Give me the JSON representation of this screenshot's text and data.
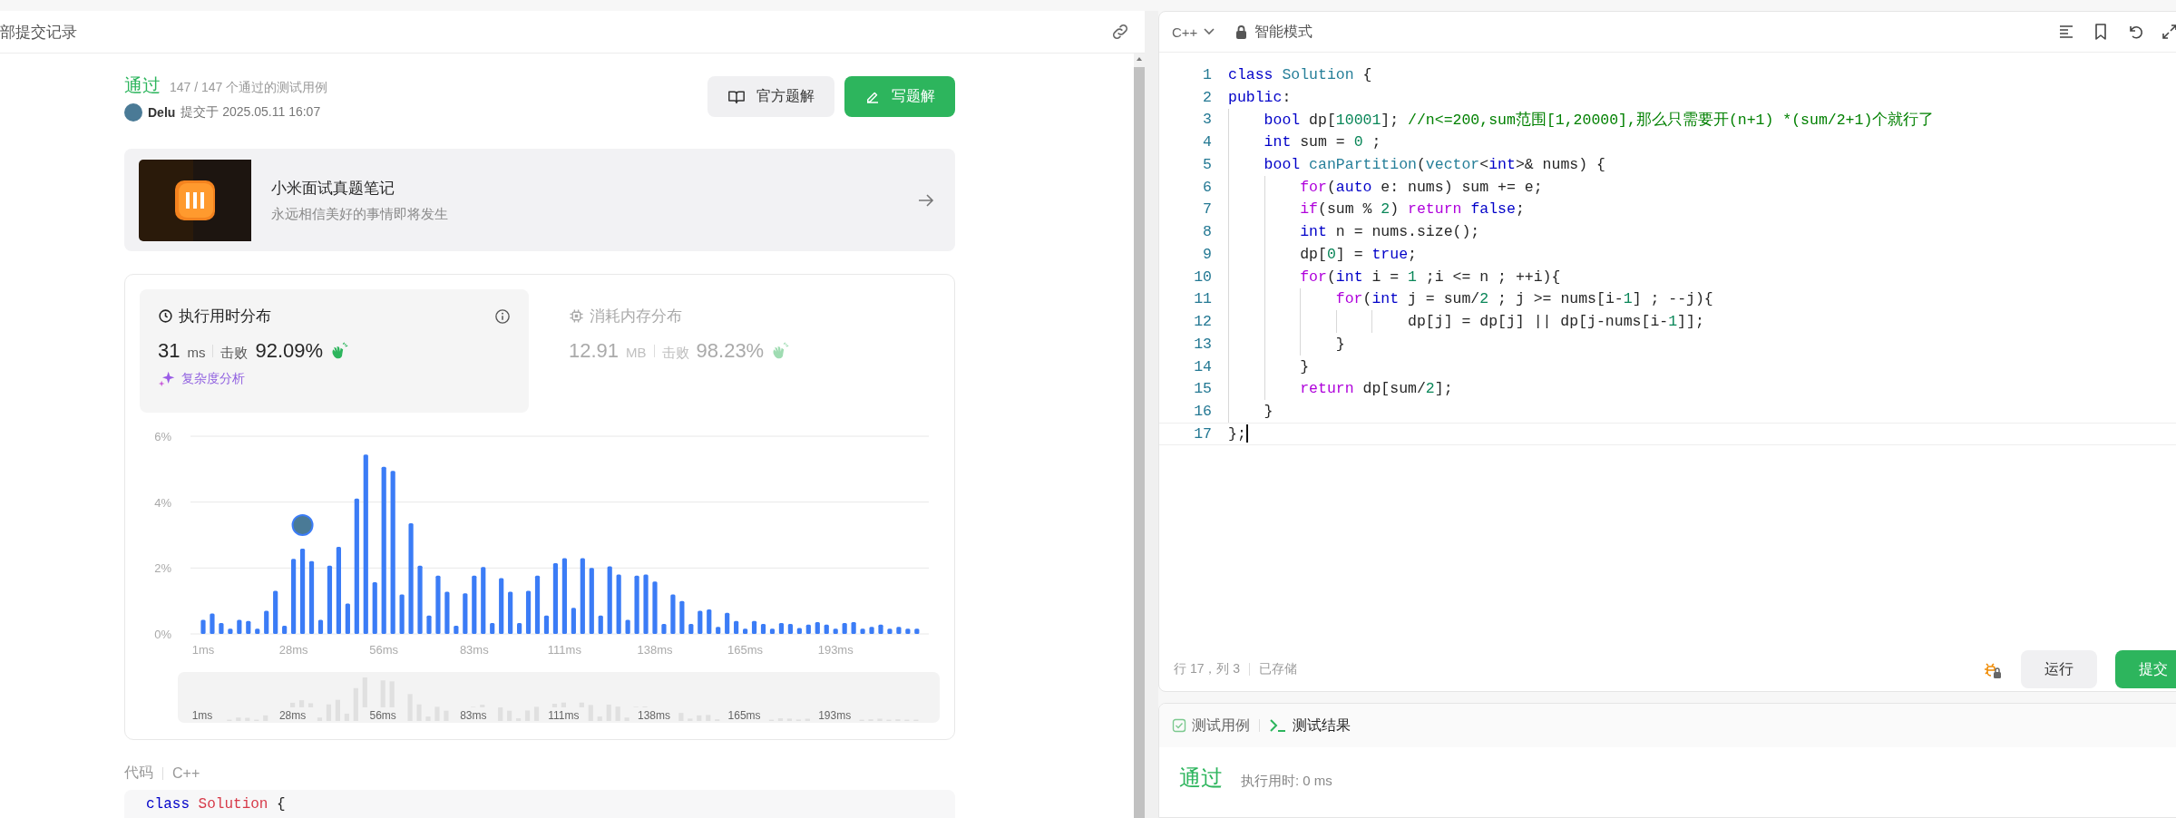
{
  "left_header": {
    "title": "部提交记录"
  },
  "submission": {
    "status": "通过",
    "cases": "147 / 147 个通过的测试用例",
    "user": "Delu",
    "submitted": "提交于 2025.05.11 16:07",
    "buttons": [
      {
        "label": "官方题解",
        "kind": "secondary"
      },
      {
        "label": "写题解",
        "kind": "primary"
      }
    ]
  },
  "promo": {
    "title": "小米面试真题笔记",
    "subtitle": "永远相信美好的事情即将发生"
  },
  "stats_tabs": [
    {
      "title": "执行用时分布",
      "selected": true,
      "kind": "runtime",
      "value": "31",
      "unit": "ms",
      "beats_label": "击败",
      "beats": "92.09%",
      "link": "复杂度分析"
    },
    {
      "title": "消耗内存分布",
      "selected": false,
      "kind": "memory",
      "value": "12.91",
      "unit": "MB",
      "beats_label": "击败",
      "beats": "98.23%"
    }
  ],
  "distribution": {
    "chart_data": {
      "type": "bar",
      "color": "#3b7cf6",
      "values": [
        0.43,
        0.62,
        0.33,
        0.16,
        0.43,
        0.39,
        0.16,
        0.7,
        1.31,
        0.25,
        2.28,
        2.59,
        2.21,
        0.43,
        2.07,
        2.64,
        0.92,
        4.11,
        5.44,
        1.57,
        5.07,
        4.95,
        1.2,
        3.36,
        2.07,
        0.56,
        1.77,
        1.28,
        0.25,
        1.23,
        1.77,
        2.03,
        0.33,
        1.69,
        1.28,
        0.33,
        1.31,
        1.77,
        0.56,
        2.15,
        2.3,
        0.79,
        2.3,
        2.0,
        0.56,
        2.05,
        1.8,
        0.43,
        1.77,
        1.8,
        1.59,
        0.3,
        1.2,
        1.0,
        0.3,
        0.7,
        0.74,
        0.21,
        0.64,
        0.39,
        0.16,
        0.39,
        0.3,
        0.16,
        0.33,
        0.3,
        0.18,
        0.28,
        0.36,
        0.28,
        0.16,
        0.33,
        0.36,
        0.16,
        0.21,
        0.28,
        0.16,
        0.21,
        0.16,
        0.16
      ],
      "ylim": [
        0,
        6
      ],
      "yticks": [
        {
          "value": 0,
          "label": "0%"
        },
        {
          "value": 2,
          "label": "2%"
        },
        {
          "value": 4,
          "label": "4%"
        },
        {
          "value": 6,
          "label": "6%"
        }
      ],
      "categories": [
        "1ms",
        null,
        null,
        null,
        null,
        null,
        null,
        null,
        null,
        null,
        "28ms",
        null,
        null,
        null,
        null,
        null,
        null,
        null,
        null,
        null,
        "56ms",
        null,
        null,
        null,
        null,
        null,
        null,
        null,
        null,
        null,
        "83ms",
        null,
        null,
        null,
        null,
        null,
        null,
        null,
        null,
        null,
        "111ms",
        null,
        null,
        null,
        null,
        null,
        null,
        null,
        null,
        null,
        "138ms",
        null,
        null,
        null,
        null,
        null,
        null,
        null,
        null,
        null,
        "165ms",
        null,
        null,
        null,
        null,
        null,
        null,
        null,
        null,
        null,
        "193ms",
        null,
        null,
        null,
        null,
        null,
        null,
        null,
        null,
        null
      ]
    },
    "avatar_marker": {
      "shown": true
    },
    "overview_labels": [
      "1ms",
      "28ms",
      "56ms",
      "83ms",
      "111ms",
      "138ms",
      "165ms",
      "193ms"
    ]
  },
  "code_section": {
    "label": "代码",
    "language": "C++",
    "first_line": [
      {
        "kind": "keyword",
        "text": "class"
      },
      {
        "kind": "name",
        "text": " Solution"
      },
      " {"
    ]
  },
  "editor": {
    "language": "C++",
    "mode": "智能模式",
    "lines": [
      {
        "number": "1",
        "active": false,
        "tokens": [
          {
            "kind": "keyword",
            "text": "class"
          },
          {
            "kind": "type",
            "text": " Solution"
          },
          " {"
        ]
      },
      {
        "number": "2",
        "active": false,
        "tokens": [
          {
            "kind": "keyword",
            "text": "public"
          },
          ":"
        ]
      },
      {
        "number": "3",
        "active": false,
        "tokens": [
          {
            "kind": "keyword",
            "text": "    bool"
          },
          " dp[",
          {
            "kind": "number",
            "text": "10001"
          },
          "]; ",
          {
            "kind": "comment",
            "text": "//n<=200,sum范围[1,20000],那么只需要开(n+1) *(sum/2+1)个就行了"
          }
        ]
      },
      {
        "number": "4",
        "active": false,
        "tokens": [
          {
            "kind": "keyword",
            "text": "    int"
          },
          " sum = ",
          {
            "kind": "number",
            "text": "0"
          },
          " ;"
        ]
      },
      {
        "number": "5",
        "active": false,
        "tokens": [
          {
            "kind": "keyword",
            "text": "    bool"
          },
          {
            "kind": "type",
            "text": " canPartition"
          },
          "(",
          {
            "kind": "type",
            "text": "vector"
          },
          "<",
          {
            "kind": "keyword",
            "text": "int"
          },
          ">& nums) {"
        ]
      },
      {
        "number": "6",
        "active": false,
        "tokens": [
          {
            "kind": "control",
            "text": "        for"
          },
          "(",
          {
            "kind": "keyword",
            "text": "auto"
          },
          " e: nums) sum += e;"
        ]
      },
      {
        "number": "7",
        "active": false,
        "tokens": [
          {
            "kind": "control",
            "text": "        if"
          },
          "(sum % ",
          {
            "kind": "number",
            "text": "2"
          },
          ") ",
          {
            "kind": "control",
            "text": "return"
          },
          {
            "kind": "keyword",
            "text": " false"
          },
          ";"
        ]
      },
      {
        "number": "8",
        "active": false,
        "tokens": [
          {
            "kind": "keyword",
            "text": "        int"
          },
          " n = nums.size();"
        ]
      },
      {
        "number": "9",
        "active": false,
        "tokens": [
          "        dp[",
          {
            "kind": "number",
            "text": "0"
          },
          "] = ",
          {
            "kind": "keyword",
            "text": "true"
          },
          ";"
        ]
      },
      {
        "number": "10",
        "active": false,
        "tokens": [
          {
            "kind": "control",
            "text": "        for"
          },
          "(",
          {
            "kind": "keyword",
            "text": "int"
          },
          " i = ",
          {
            "kind": "number",
            "text": "1"
          },
          " ;i <= n ; ++i){"
        ]
      },
      {
        "number": "11",
        "active": false,
        "tokens": [
          {
            "kind": "control",
            "text": "            for"
          },
          "(",
          {
            "kind": "keyword",
            "text": "int"
          },
          " j = sum/",
          {
            "kind": "number",
            "text": "2"
          },
          " ; j >= nums[i-",
          {
            "kind": "number",
            "text": "1"
          },
          "] ; --j){"
        ]
      },
      {
        "number": "12",
        "active": false,
        "tokens": [
          "                    dp[j] = dp[j] || dp[j-nums[i-",
          {
            "kind": "number",
            "text": "1"
          },
          "]];"
        ]
      },
      {
        "number": "13",
        "active": false,
        "tokens": [
          "            }"
        ]
      },
      {
        "number": "14",
        "active": false,
        "tokens": [
          "        }"
        ]
      },
      {
        "number": "15",
        "active": false,
        "tokens": [
          {
            "kind": "control",
            "text": "        return"
          },
          " dp[sum/",
          {
            "kind": "number",
            "text": "2"
          },
          "];"
        ]
      },
      {
        "number": "16",
        "active": false,
        "tokens": [
          "    }"
        ]
      },
      {
        "number": "17",
        "active": true,
        "tokens": [
          "};"
        ]
      }
    ],
    "status": {
      "position": "行 17，列 3",
      "saved": "已存储"
    },
    "buttons": [
      {
        "label": "运行",
        "kind": "secondary"
      },
      {
        "label": "提交",
        "kind": "primary"
      }
    ]
  },
  "console": {
    "tabs": [
      {
        "label": "测试用例",
        "selected": false,
        "kind": "cases"
      },
      {
        "label": "测试结果",
        "selected": true,
        "kind": "result"
      }
    ],
    "result": "通过",
    "runtime": "执行用时: 0 ms"
  }
}
